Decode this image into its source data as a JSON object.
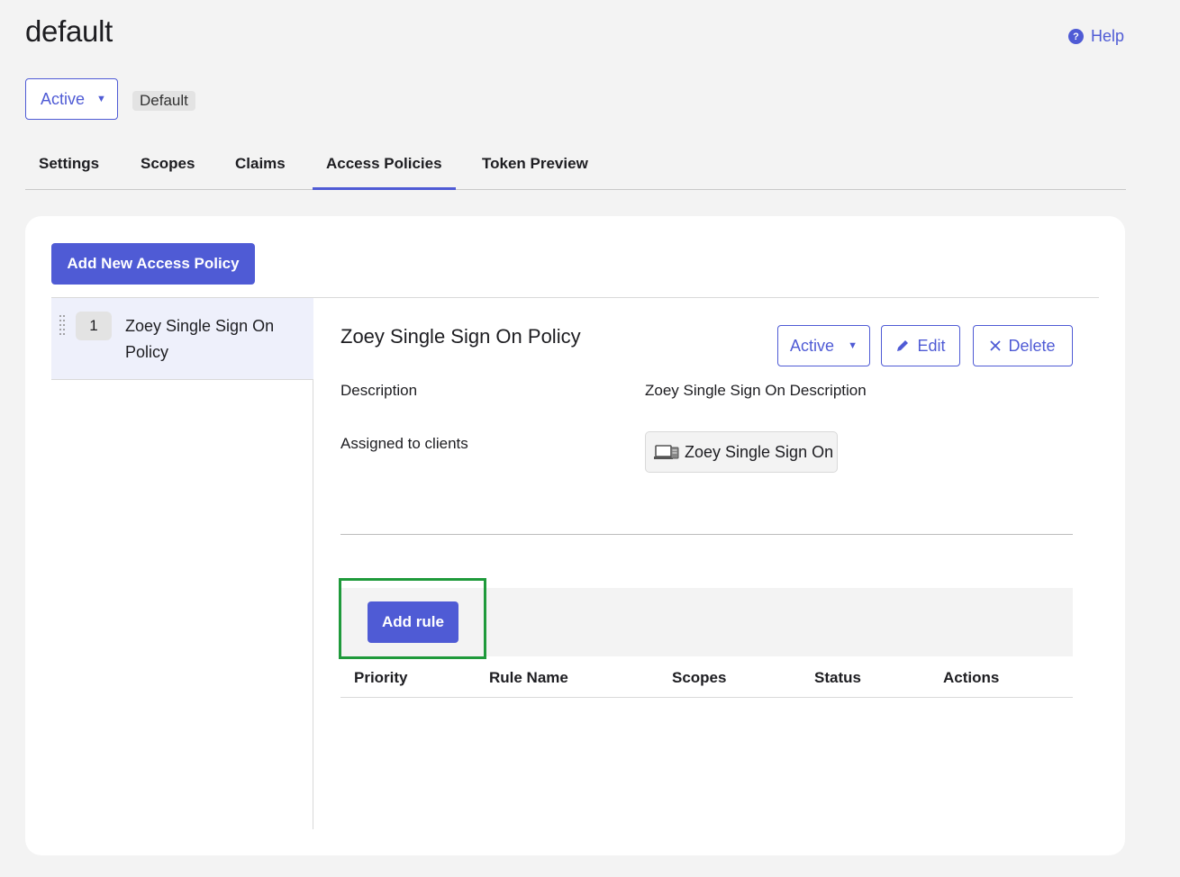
{
  "header": {
    "title": "default",
    "help_label": "Help"
  },
  "status": {
    "selected": "Active",
    "badge": "Default"
  },
  "tabs": [
    {
      "label": "Settings"
    },
    {
      "label": "Scopes"
    },
    {
      "label": "Claims"
    },
    {
      "label": "Access Policies",
      "active": true
    },
    {
      "label": "Token Preview"
    }
  ],
  "policies": {
    "add_button": "Add New Access Policy",
    "items": [
      {
        "order": "1",
        "name": "Zoey Single Sign On Policy"
      }
    ]
  },
  "detail": {
    "title": "Zoey Single Sign On Policy",
    "status_label": "Active",
    "edit_label": "Edit",
    "delete_label": "Delete",
    "description_label": "Description",
    "description_value": "Zoey Single Sign On Description",
    "assigned_label": "Assigned to clients",
    "client_name": "Zoey Single Sign On"
  },
  "rules": {
    "add_button": "Add rule",
    "columns": [
      "Priority",
      "Rule Name",
      "Scopes",
      "Status",
      "Actions"
    ]
  },
  "colors": {
    "accent": "#4f5bd5",
    "highlight": "#1f9a3b",
    "page_bg": "#f3f3f3"
  },
  "icons": {
    "help": "help-circle-icon",
    "caret": "caret-down-icon",
    "grip": "drag-handle-icon",
    "edit": "pencil-icon",
    "delete": "close-icon",
    "client": "client-app-icon"
  }
}
